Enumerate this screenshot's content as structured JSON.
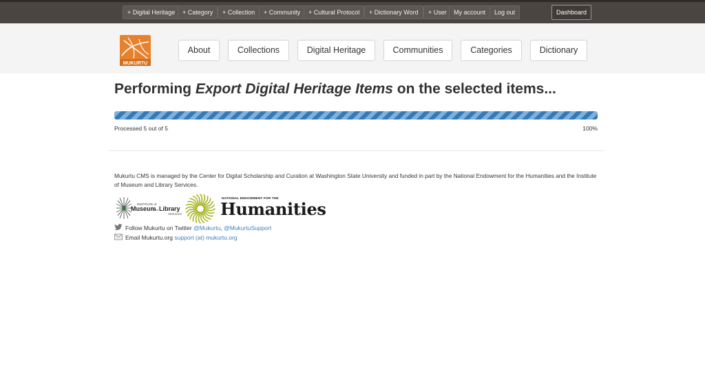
{
  "admin_bar": {
    "items": [
      "+ Digital Heritage",
      "+ Category",
      "+ Collection",
      "+ Community",
      "+ Cultural Protocol",
      "+ Dictionary Word",
      "+ User",
      "My account",
      "Log out"
    ],
    "dashboard": "Dashboard"
  },
  "logo": {
    "text": "MUKURTU",
    "color": "#e8812c"
  },
  "nav": {
    "items": [
      "About",
      "Collections",
      "Digital Heritage",
      "Communities",
      "Categories",
      "Dictionary"
    ]
  },
  "batch": {
    "title_prefix": "Performing ",
    "title_operation": "Export Digital Heritage Items",
    "title_suffix": " on the selected items...",
    "progress_fraction": 1.0,
    "message": "Processed 5 out of 5",
    "percent_label": "100%"
  },
  "footer": {
    "credit": "Mukurtu CMS is managed by the Center for Digital Scholarship and Curation at Washington State University and funded in part by the National Endowment for the Humanities and the Institute of Museum and Library Services.",
    "imls_lines": [
      "INSTITUTE of",
      "Museum",
      "and",
      "Library",
      "SERVICES"
    ],
    "neh_small": "NATIONAL ENDOWMENT FOR THE",
    "neh_big": "Humanities",
    "twitter_prefix": "Follow Mukurtu on Twitter ",
    "twitter_handle_1": "@Mukurtu",
    "twitter_sep": ", ",
    "twitter_handle_2": "@MukurtuSupport",
    "email_prefix": "Email Mukurtu.org ",
    "email_address": "support (at) mukurtu.org",
    "twitter_icon": "twitter-bird-icon",
    "email_icon": "envelope-icon"
  }
}
